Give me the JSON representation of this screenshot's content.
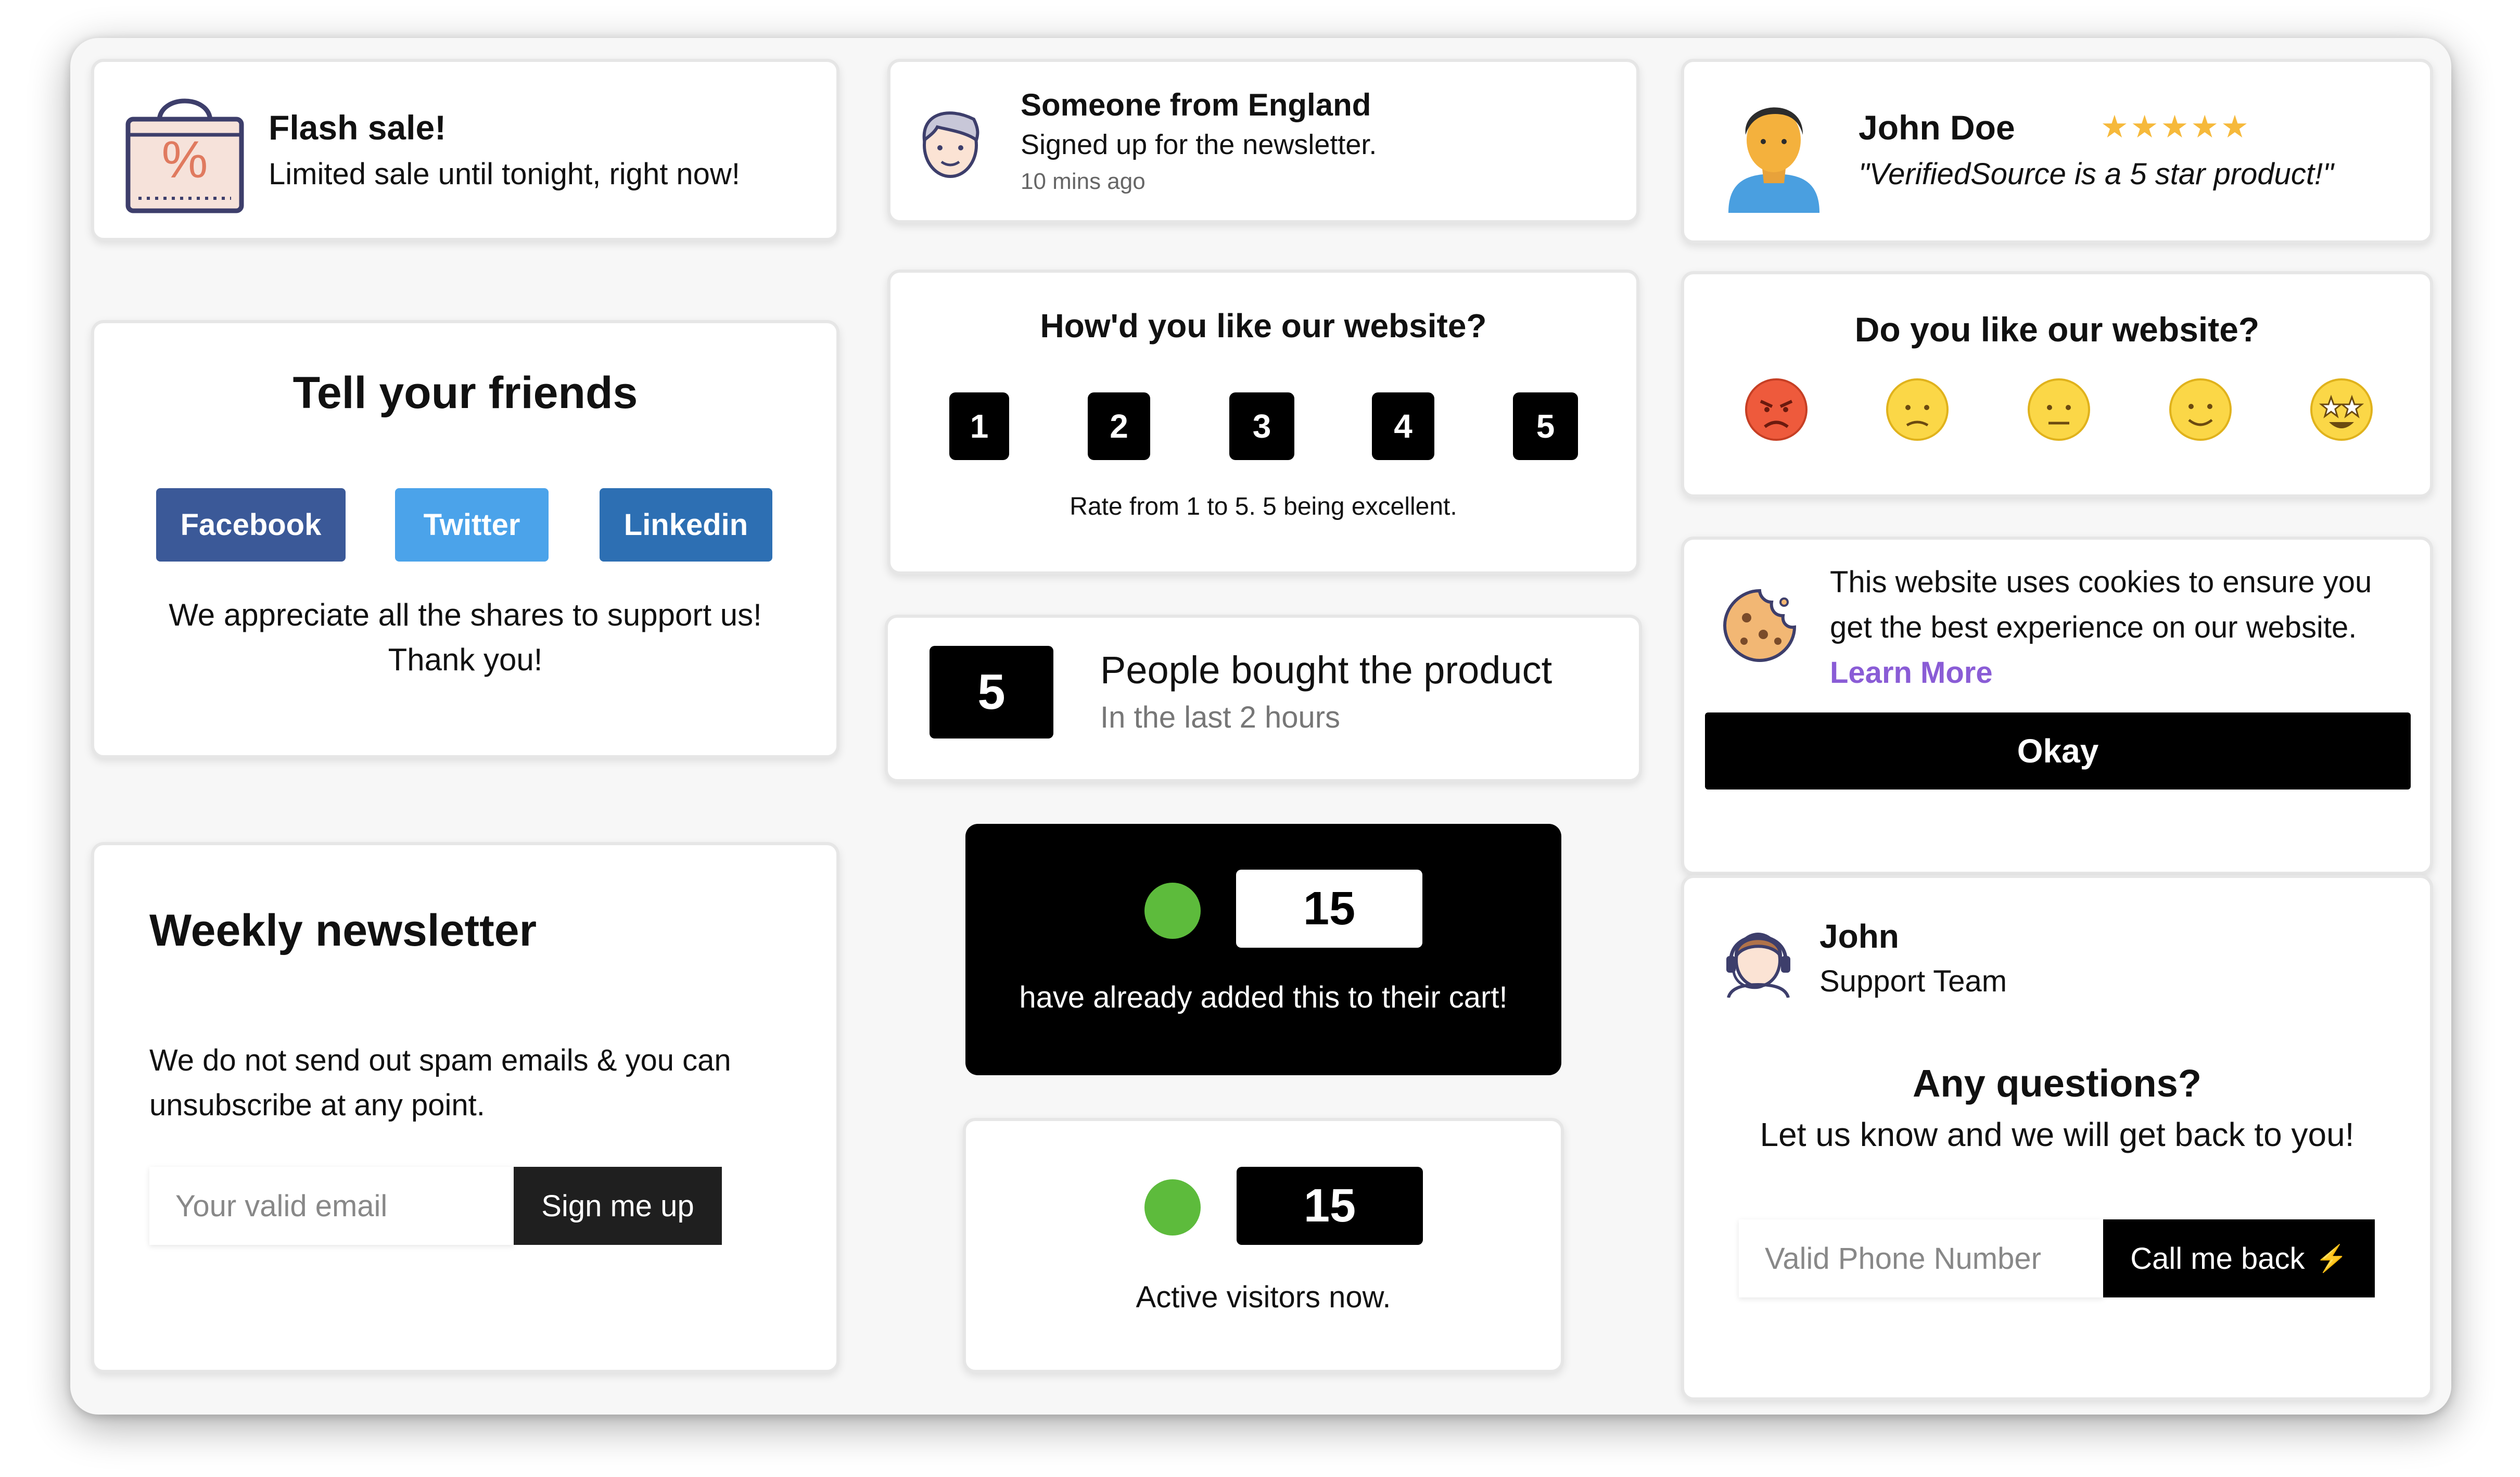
{
  "flash": {
    "title": "Flash sale!",
    "text": "Limited sale until tonight, right now!",
    "bag_symbol": "%",
    "icon": "shopping-bag-icon"
  },
  "signup": {
    "title": "Someone from England",
    "text": "Signed up for the newsletter.",
    "time": "10 mins ago",
    "icon": "man-face-icon"
  },
  "review": {
    "name": "John Doe",
    "stars": "★★★★★",
    "rating": 5,
    "quote": "\"VerifiedSource is a 5 star product!\"",
    "icon": "person-avatar-icon",
    "star_color": "#f6b93b"
  },
  "share": {
    "title": "Tell your friends",
    "buttons": [
      "Facebook",
      "Twitter",
      "Linkedin"
    ],
    "text1": "We appreciate all the shares to support us!",
    "text2": "Thank you!",
    "colors": {
      "facebook": "#3b5998",
      "twitter": "#4ba3ea",
      "linkedin": "#2d6fb3"
    }
  },
  "rating": {
    "question": "How'd you like our website?",
    "options": [
      "1",
      "2",
      "3",
      "4",
      "5"
    ],
    "caption": "Rate from 1 to 5. 5 being excellent."
  },
  "emoji": {
    "question": "Do you like our website?",
    "faces": [
      "angry-face-icon",
      "sad-face-icon",
      "neutral-face-icon",
      "smiling-face-icon",
      "star-struck-face-icon"
    ]
  },
  "bought": {
    "count": "5",
    "title": "People bought the product",
    "subtitle": "In the last 2 hours"
  },
  "cookies": {
    "line1": "This website uses cookies to ensure you",
    "line2": "get the best experience on our website.",
    "link": "Learn More",
    "button": "Okay",
    "link_color": "#8a5cd6",
    "icon": "cookie-icon"
  },
  "newsletter": {
    "title": "Weekly newsletter",
    "line1": "We do not send out spam emails & you can",
    "line2": "unsubscribe at any point.",
    "placeholder": "Your valid email",
    "button": "Sign me up"
  },
  "cart": {
    "count": "15",
    "text": "have already added this to their cart!",
    "dot_color": "#5dbb3c"
  },
  "visitors": {
    "count": "15",
    "text": "Active visitors now."
  },
  "support": {
    "name": "John",
    "role": "Support Team",
    "question": "Any questions?",
    "text": "Let us know and we will get back to you!",
    "placeholder": "Valid Phone Number",
    "button": "Call me back",
    "button_icon": "⚡",
    "icon": "support-agent-icon"
  }
}
